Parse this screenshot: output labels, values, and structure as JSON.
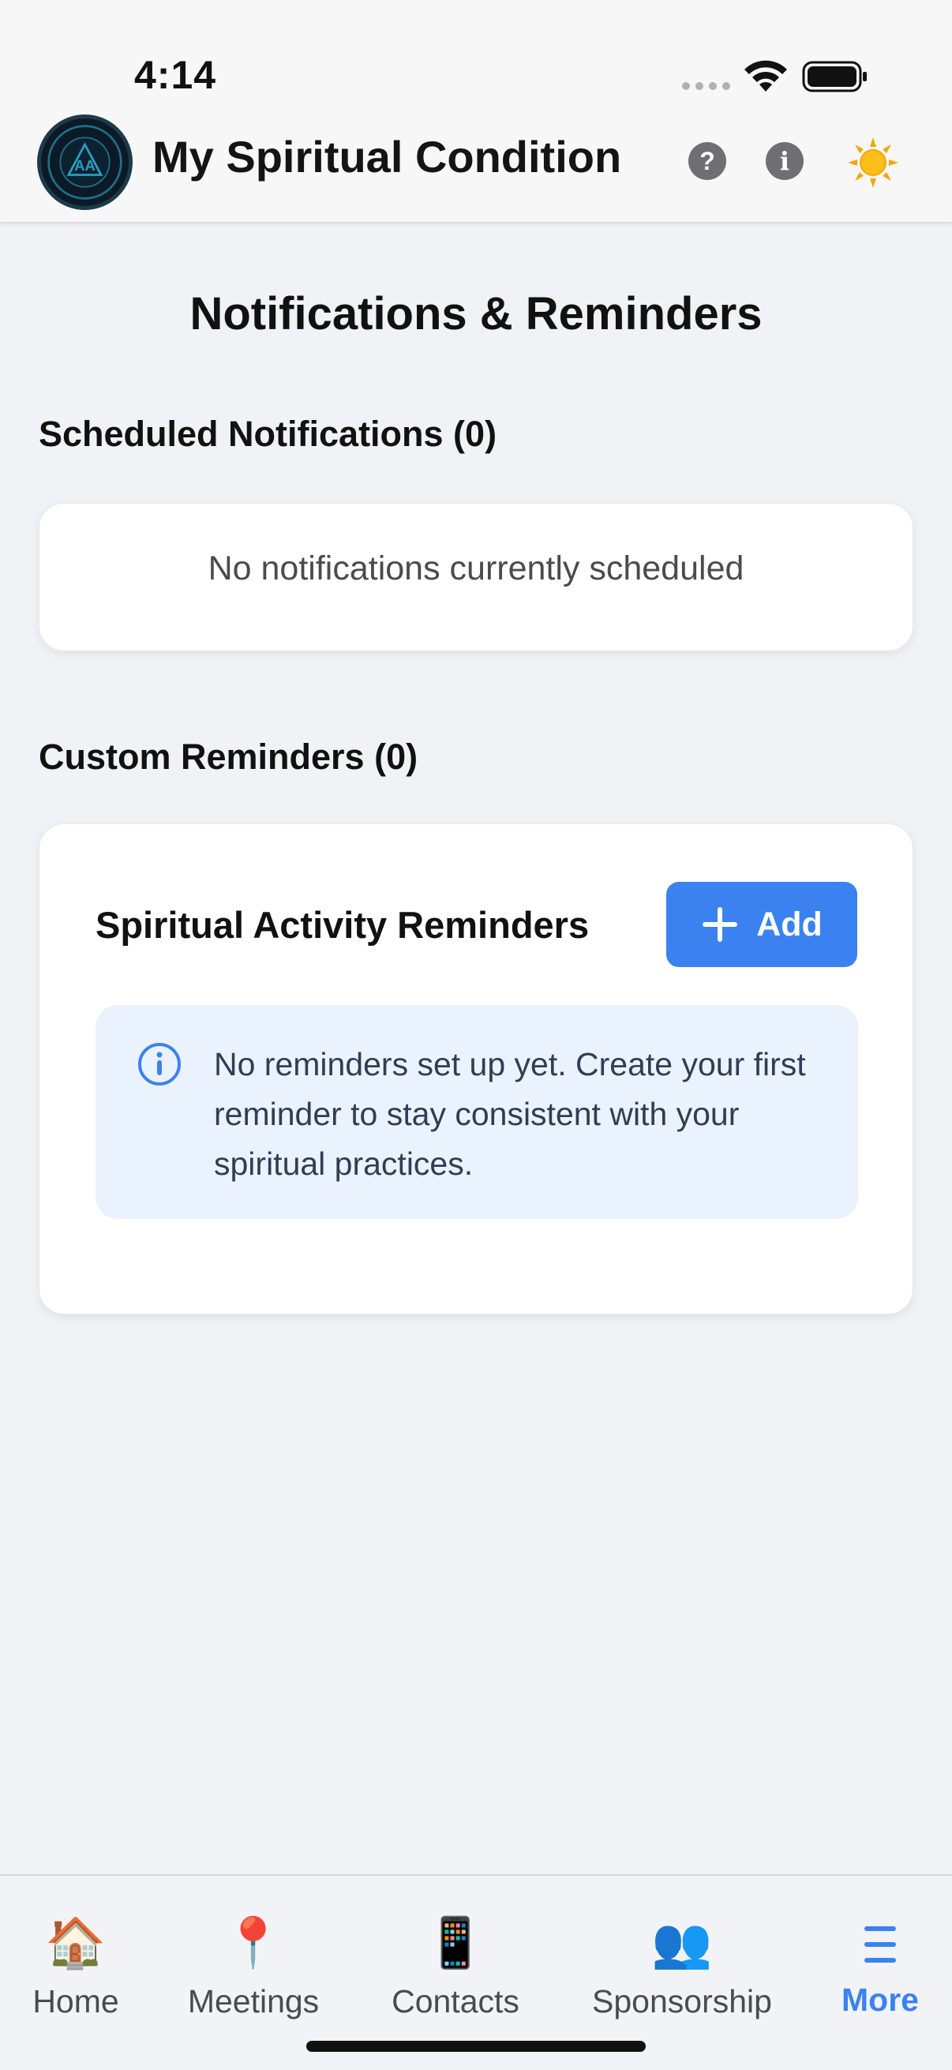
{
  "status_bar": {
    "time": "4:14"
  },
  "header": {
    "title": "My Spiritual Condition",
    "logo_text": "SPIRITUAL CONDITION TRACKER",
    "help_glyph": "?",
    "info_glyph": "i",
    "icons": [
      "help-icon",
      "info-icon",
      "sun-icon"
    ]
  },
  "page": {
    "title": "Notifications & Reminders",
    "scheduled": {
      "title": "Scheduled Notifications (0)",
      "empty_text": "No notifications currently scheduled"
    },
    "custom": {
      "title": "Custom Reminders (0)",
      "card_heading": "Spiritual Activity Reminders",
      "add_label": "Add",
      "info_text": "No reminders set up yet. Create your first reminder to stay consistent with your spiritual practices."
    }
  },
  "tabs": [
    {
      "label": "Home",
      "icon": "🏠"
    },
    {
      "label": "Meetings",
      "icon": "📍"
    },
    {
      "label": "Contacts",
      "icon": "📱"
    },
    {
      "label": "Sponsorship",
      "icon": "👥"
    },
    {
      "label": "More",
      "icon": "menu-icon"
    }
  ],
  "colors": {
    "accent": "#3b82f0",
    "info_bg": "#eaf3fd",
    "background": "#f0f2f6"
  }
}
